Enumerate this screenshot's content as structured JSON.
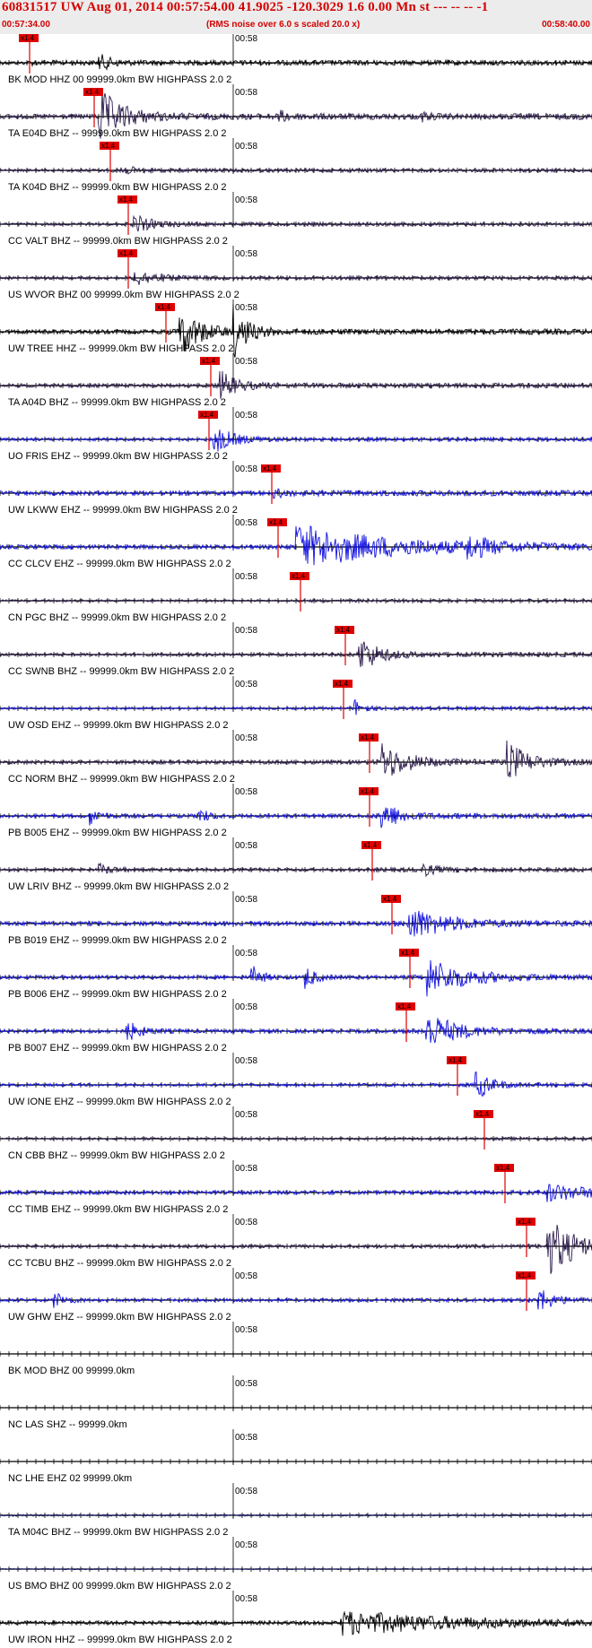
{
  "header": {
    "title": "60831517 UW Aug 01, 2014 00:57:54.00   41.9025 -120.3029  1.6 0.00 Mn st --- -- --   -1",
    "start_time": "00:57:34.00",
    "note": "(RMS noise over 6.0 s scaled 20.0 x)",
    "end_time": "00:58:40.00"
  },
  "colors": {
    "header_text": "#d40000",
    "header_bg": "#ececec",
    "pick_fill": "#e00000",
    "pick_line": "#e00000",
    "trace_dark": "#2a1a4a",
    "trace_blue": "#1010e0",
    "trace_black": "#000000",
    "trace_navy": "#1a1a6e"
  },
  "chart_data": {
    "type": "line",
    "title": "60831517 UW Aug 01, 2014 00:57:54.00   41.9025 -120.3029  1.6 0.00 Mn st --- -- --   -1",
    "x_range_seconds": [
      0,
      66
    ],
    "tick_interval_seconds": 1,
    "minute_mark_label": "00:58",
    "minute_mark_second": 26,
    "pick_label": "x1.4",
    "traces": [
      {
        "label": "",
        "amp": 8,
        "color": "#000000",
        "pick": 3.3,
        "env": [
          [
            3.3,
            0.4,
            1.0
          ],
          [
            11,
            1.2,
            5.5
          ]
        ]
      },
      {
        "label": "BK MOD HHZ 00 99999.0km BW  HIGHPASS  2.0   2",
        "amp": 10,
        "color": "#2a1a4a",
        "pick": 10.5,
        "env": [
          [
            11,
            2.5,
            14
          ],
          [
            31,
            1.2,
            2.5
          ],
          [
            47,
            0.8,
            1.8
          ]
        ]
      },
      {
        "label": "TA E04D BHZ -- 99999.0km BW  HIGHPASS  2.0   2",
        "amp": 6,
        "color": "#2a1a4a",
        "pick": 12.3,
        "env": [
          [
            13,
            1.5,
            5
          ]
        ]
      },
      {
        "label": "TA K04D BHZ -- 99999.0km BW  HIGHPASS  2.0   2",
        "amp": 6,
        "color": "#2a1a4a",
        "pick": 14.3,
        "env": [
          [
            14.8,
            2,
            8
          ]
        ]
      },
      {
        "label": "CC VALT BHZ -- 99999.0km BW  HIGHPASS  2.0   2",
        "amp": 6,
        "color": "#2a1a4a",
        "pick": 14.3,
        "env": [
          [
            14.8,
            2.5,
            7
          ]
        ]
      },
      {
        "label": "US WVOR BHZ 00 99999.0km BW  HIGHPASS  2.0   2",
        "amp": 9,
        "color": "#000000",
        "pick": 18.5,
        "env": [
          [
            20,
            2.2,
            14
          ],
          [
            26,
            1.5,
            14
          ]
        ]
      },
      {
        "label": "UW TREE HHZ -- 99999.0km BW  HIGHPASS  2.0   2",
        "amp": 8,
        "color": "#2a1a4a",
        "pick": 23.5,
        "env": [
          [
            24.5,
            1.8,
            9
          ]
        ]
      },
      {
        "label": "TA A04D BHZ -- 99999.0km BW  HIGHPASS  2.0   2",
        "amp": 6,
        "color": "#1010e0",
        "pick": 23.3,
        "env": [
          [
            23.8,
            2,
            12
          ]
        ]
      },
      {
        "label": "UO FRIS EHZ -- 99999.0km BW  HIGHPASS  2.0   2",
        "amp": 9,
        "color": "#1010e0",
        "pick": 30.3,
        "env": [
          [
            30.5,
            1.2,
            2
          ]
        ]
      },
      {
        "label": "UW LKWW EHZ -- 99999.0km BW  HIGHPASS  2.0   2",
        "amp": 9,
        "color": "#1010e0",
        "pick": 31.0,
        "env": [
          [
            33,
            10,
            12
          ],
          [
            52,
            2.5,
            5.5
          ]
        ]
      },
      {
        "label": "CC CLCV EHZ -- 99999.0km BW  HIGHPASS  2.0   2",
        "amp": 5,
        "color": "#2a1a4a",
        "pick": 33.5,
        "env": []
      },
      {
        "label": "CN PGC BHZ -- 99999.0km BW  HIGHPASS  2.0   2",
        "amp": 7,
        "color": "#2a1a4a",
        "pick": 38.5,
        "env": [
          [
            40,
            2,
            14
          ]
        ]
      },
      {
        "label": "CC SWNB BHZ -- 99999.0km BW  HIGHPASS  2.0   2",
        "amp": 5,
        "color": "#1010e0",
        "pick": 38.3,
        "env": [
          [
            39.5,
            0.8,
            10
          ]
        ]
      },
      {
        "label": "UW OSD EHZ -- 99999.0km BW  HIGHPASS  2.0   2",
        "amp": 8,
        "color": "#2a1a4a",
        "pick": 41.2,
        "env": [
          [
            42.5,
            2.8,
            12
          ],
          [
            56.5,
            2.2,
            13
          ]
        ]
      },
      {
        "label": "CC NORM BHZ -- 99999.0km BW  HIGHPASS  2.0   2",
        "amp": 8,
        "color": "#1010e0",
        "pick": 41.2,
        "env": [
          [
            42.5,
            1.8,
            10
          ],
          [
            10,
            1,
            6
          ],
          [
            22,
            1,
            6
          ]
        ]
      },
      {
        "label": "PB B005 EHZ -- 99999.0km BW  HIGHPASS  2.0   2",
        "amp": 7,
        "color": "#2a1a4a",
        "pick": 41.5,
        "env": [
          [
            11,
            1.5,
            4
          ],
          [
            47,
            1.2,
            5
          ]
        ]
      },
      {
        "label": "UW LRIV BHZ -- 99999.0km BW  HIGHPASS  2.0   2",
        "amp": 9,
        "color": "#1010e0",
        "pick": 43.7,
        "env": [
          [
            45.5,
            4,
            9
          ]
        ]
      },
      {
        "label": "PB B019 EHZ -- 99999.0km BW  HIGHPASS  2.0   2",
        "amp": 8,
        "color": "#1010e0",
        "pick": 45.7,
        "env": [
          [
            47.5,
            4,
            12
          ],
          [
            28,
            1,
            8
          ],
          [
            34,
            1,
            8
          ]
        ]
      },
      {
        "label": "PB B006 EHZ -- 99999.0km BW  HIGHPASS  2.0   2",
        "amp": 8,
        "color": "#1010e0",
        "pick": 45.3,
        "env": [
          [
            47.5,
            3,
            12
          ],
          [
            14,
            1.5,
            7
          ]
        ]
      },
      {
        "label": "PB B007 EHZ -- 99999.0km BW  HIGHPASS  2.0   2",
        "amp": 6,
        "color": "#1010e0",
        "pick": 51.0,
        "env": [
          [
            53,
            1.5,
            14
          ]
        ]
      },
      {
        "label": "UW IONE EHZ -- 99999.0km BW  HIGHPASS  2.0   2",
        "amp": 5,
        "color": "#2a1a4a",
        "pick": 54.0,
        "env": []
      },
      {
        "label": "CN CBB BHZ -- 99999.0km BW  HIGHPASS  2.0   2",
        "amp": 8,
        "color": "#1010e0",
        "pick": 56.3,
        "env": [
          [
            61,
            5,
            5
          ]
        ]
      },
      {
        "label": "CC TIMB EHZ -- 99999.0km BW  HIGHPASS  2.0   2",
        "amp": 7,
        "color": "#2a1a4a",
        "pick": 58.7,
        "env": [
          [
            61,
            3,
            22
          ]
        ]
      },
      {
        "label": "CC TCBU BHZ -- 99999.0km BW  HIGHPASS  2.0   2",
        "amp": 7,
        "color": "#1010e0",
        "pick": 58.7,
        "env": [
          [
            60,
            1.5,
            9
          ],
          [
            6,
            1.2,
            6
          ]
        ]
      },
      {
        "label": "UW GHW EHZ -- 99999.0km BW  HIGHPASS  2.0   2",
        "amp": 0,
        "color": "#000000",
        "pick": null,
        "env": []
      },
      {
        "label": "BK MOD BHZ 00 99999.0km",
        "amp": 0,
        "color": "#000000",
        "pick": null,
        "env": []
      },
      {
        "label": "NC LAS SHZ -- 99999.0km",
        "amp": 0,
        "color": "#000000",
        "pick": null,
        "env": []
      },
      {
        "label": "NC LHE EHZ 02 99999.0km",
        "amp": 3,
        "color": "#1a1a6e",
        "pick": null,
        "env": []
      },
      {
        "label": "TA M04C BHZ -- 99999.0km BW  HIGHPASS  2.0   2",
        "amp": 2,
        "color": "#1a1a6e",
        "pick": null,
        "env": []
      },
      {
        "label": "US BMO BHZ 00 99999.0km BW  HIGHPASS  2.0   2",
        "amp": 6,
        "color": "#000000",
        "pick": null,
        "env": [
          [
            38,
            14,
            10
          ]
        ]
      }
    ],
    "last_label": "UW IRON HHZ -- 99999.0km BW  HIGHPASS  2.0   2"
  }
}
